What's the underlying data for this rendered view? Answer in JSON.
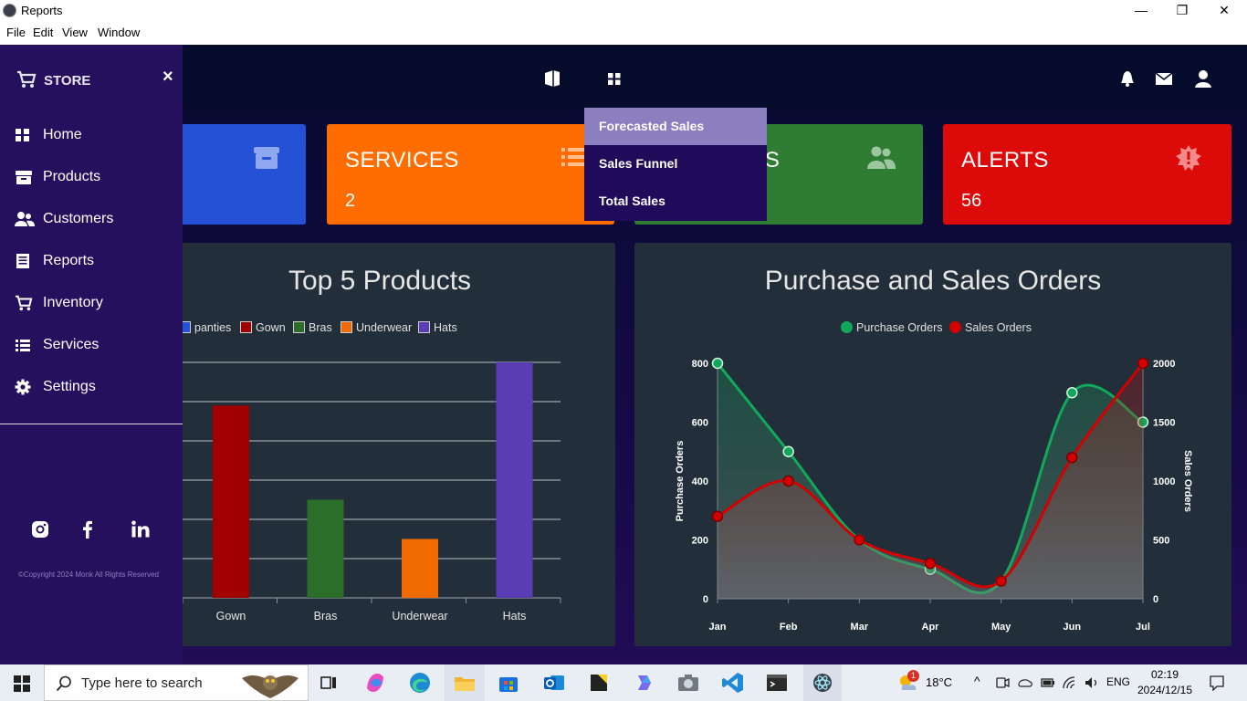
{
  "window": {
    "title": "Reports",
    "minimize": "—",
    "maximize": "❐",
    "close": "✕"
  },
  "menu": [
    "File",
    "Edit",
    "View",
    "Window"
  ],
  "sidebar": {
    "brand": "STORE",
    "close": "×",
    "items": [
      {
        "label": "Home",
        "icon": "grid-icon"
      },
      {
        "label": "Products",
        "icon": "box-icon"
      },
      {
        "label": "Customers",
        "icon": "users-icon"
      },
      {
        "label": "Reports",
        "icon": "report-icon"
      },
      {
        "label": "Inventory",
        "icon": "cart-icon"
      },
      {
        "label": "Services",
        "icon": "list-icon"
      },
      {
        "label": "Settings",
        "icon": "gear-icon"
      }
    ],
    "copyright": "©Copyright 2024 Monk All Rights Reserved"
  },
  "dropdown": {
    "items": [
      "Forecasted Sales",
      "Sales Funnel",
      "Total Sales"
    ],
    "active_index": 0
  },
  "cards": [
    {
      "title": "",
      "value": "",
      "color": "#2451d6",
      "icon": "archive-icon"
    },
    {
      "title": "SERVICES",
      "value": "2",
      "color": "#ff6d00",
      "icon": "list-icon"
    },
    {
      "title": "RS",
      "value": "",
      "color": "#2e7d32",
      "icon": "users-icon"
    },
    {
      "title": "ALERTS",
      "value": "56",
      "color": "#dd0a0a",
      "icon": "alert-icon"
    }
  ],
  "colors": {
    "sidebar": "#25105e",
    "panel": "#222f3a",
    "dropdown_active": "#8b7fbf"
  },
  "chart_data": [
    {
      "type": "bar",
      "title": "Top 5 Products",
      "legend": [
        {
          "name": "panties",
          "color": "#2451d6"
        },
        {
          "name": "Gown",
          "color": "#a00000"
        },
        {
          "name": "Bras",
          "color": "#2a6e2a"
        },
        {
          "name": "Underwear",
          "color": "#f06a00"
        },
        {
          "name": "Hats",
          "color": "#5a3db5"
        }
      ],
      "categories": [
        "Gown",
        "Bras",
        "Underwear",
        "Hats"
      ],
      "values": [
        4.9,
        2.5,
        1.5,
        6.0
      ],
      "ylim": [
        0,
        6
      ],
      "grid": true
    },
    {
      "type": "line",
      "title": "Purchase and Sales Orders",
      "categories": [
        "Jan",
        "Feb",
        "Mar",
        "Apr",
        "May",
        "Jun",
        "Jul"
      ],
      "series": [
        {
          "name": "Purchase Orders",
          "color": "#10a85a",
          "axis": "left",
          "values": [
            800,
            500,
            200,
            100,
            60,
            700,
            600
          ]
        },
        {
          "name": "Sales Orders",
          "color": "#d40000",
          "axis": "right",
          "values": [
            700,
            1000,
            500,
            300,
            150,
            1200,
            2000
          ]
        }
      ],
      "ylabel": "Purchase Orders",
      "y2label": "Sales Orders",
      "ylim": [
        0,
        800
      ],
      "y2lim": [
        0,
        2000
      ],
      "yticks": [
        "0",
        "200",
        "400",
        "600",
        "800"
      ],
      "y2ticks": [
        "0",
        "500",
        "1000",
        "1500",
        "2000"
      ],
      "legend_position": "top-center",
      "grid": false
    }
  ],
  "taskbar": {
    "search_placeholder": "Type here to search",
    "weather": "18°C",
    "weather_badge": "1",
    "language": "ENG",
    "time": "02:19",
    "date": "2024/12/15"
  }
}
